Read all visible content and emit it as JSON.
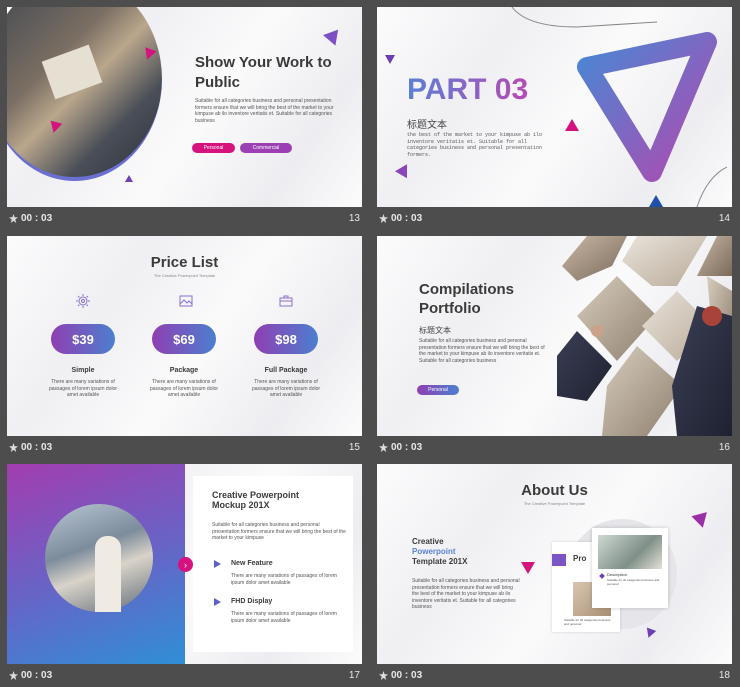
{
  "slides": [
    {
      "title": "Show Your Work to Public",
      "body": "Suitable for all categories business and personal presentation formers ensure that we will bring the best of the market to your kimpuse ab ilo inventore veritatis et. Suitable for all categories business",
      "btn1": "Personal",
      "btn2": "Commercial",
      "time": "00 : 03",
      "num": "13"
    },
    {
      "title": "PART 03",
      "sub": "标题文本",
      "body": "the best of the market to your kimpuse ab ilo inventore veritatis et. Suitable for all categories business and personal presentation formers.",
      "time": "00 : 03",
      "num": "14"
    },
    {
      "title": "Price List",
      "subtitle": "The Creative Powerpoint Template",
      "plans": [
        {
          "price": "$39",
          "name": "Simple",
          "desc": "There are many variations of passages of lorem ipsum dolor amet available"
        },
        {
          "price": "$69",
          "name": "Package",
          "desc": "There are many variations of passages of lorem ipsum dolor amet available"
        },
        {
          "price": "$98",
          "name": "Full Package",
          "desc": "There are many variations of passages of lorem ipsum dolor amet available"
        }
      ],
      "time": "00 : 03",
      "num": "15"
    },
    {
      "title": "Compilations Portfolio",
      "sub": "标题文本",
      "body": "Suitable for all categories business and personal presentation formers ensure that we will bring the best of the market to your kimpuse ab ilo inventore veritatis et. Suitable for all categories business",
      "btn": "Personal",
      "time": "00 : 03",
      "num": "16"
    },
    {
      "title": "Creative Powerpoint Mockup 201X",
      "body": "Suitable for all categories business and personal presentation formers ensure that we will bring the best of the market to your kimpuse",
      "f1": "New Feature",
      "f1d": "There are many variations of passages of lorem ipsum dolor amet available",
      "f2": "FHD Display",
      "f2d": "There are many variations of passages of lorem ipsum dolor amet available",
      "time": "00 : 03",
      "num": "17"
    },
    {
      "title": "About Us",
      "subtitle": "The Creative Powerpoint Template",
      "l1": "Creative",
      "l2": "Powerpoint",
      "l3": "Template 201X",
      "body": "Suitable for all categories business and personal presentation formers ensure that we will bring the best of the market to your kimpuse ab ilo inventore veritatis et. Suitable for all categories business",
      "card": "Pro",
      "desc": "Description",
      "descp": "Suitable for all categories business and personal",
      "cardp": "Suitable for all categories business and personal",
      "time": "00 : 03",
      "num": "18"
    }
  ],
  "colors": {
    "purple": "#9b3fb3",
    "blue": "#4b7fd0",
    "magenta": "#d6127e"
  }
}
